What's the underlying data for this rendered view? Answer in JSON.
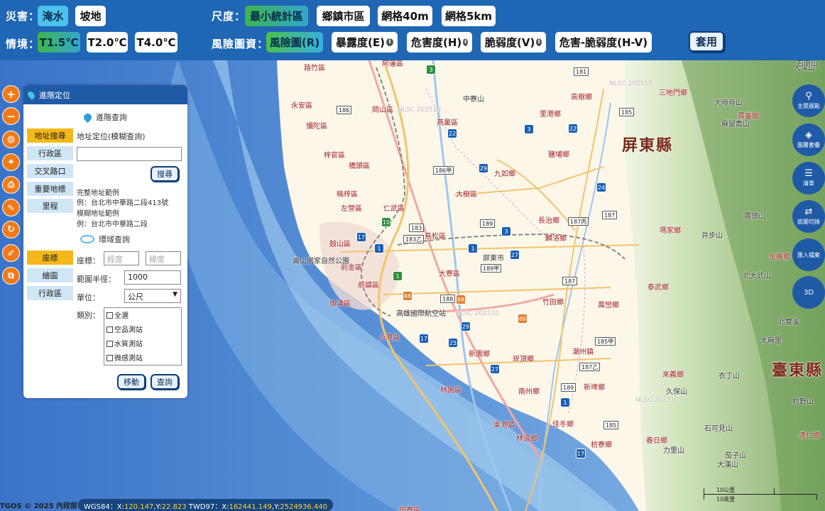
{
  "topbar": {
    "disaster_label": "災害：",
    "disaster_options": [
      "淹水",
      "坡地"
    ],
    "scenario_label": "情境：",
    "scenario_options": [
      "T1.5℃",
      "T2.0℃",
      "T4.0℃"
    ],
    "scale_label": "尺度：",
    "scale_options": [
      "最小統計區",
      "鄉鎮市區",
      "網格40m",
      "網格5km"
    ],
    "risk_label": "風險圖資：",
    "risk_options": [
      "風險圖(R)",
      "暴露度(E)",
      "危害度(H)",
      "脆弱度(V)",
      "危害-脆弱度(H-V)"
    ],
    "apply_label": "套用",
    "selected": {
      "disaster": "淹水",
      "scenario": "T1.5℃",
      "scale": "最小統計區",
      "risk": "風險圖(R)"
    },
    "colors": {
      "bar": "#1f66b5",
      "active_cyan": "#4ac2ea"
    }
  },
  "left_tools": [
    "zoom-in-icon",
    "zoom-out-icon",
    "globe-icon",
    "locate-icon",
    "print-icon",
    "measure-icon",
    "refresh-icon",
    "draw-icon",
    "layers-swap-icon"
  ],
  "panel": {
    "title": "進階定位",
    "address_section_title": "進階查詢",
    "address_tabs": [
      "地址搜尋",
      "行政區",
      "交叉路口",
      "重要地標",
      "里程"
    ],
    "address_mode_text": "地址定位(模糊查詢)",
    "address_input_value": "",
    "search_button": "搜尋",
    "examples": [
      "完整地址範例",
      "例：台北市中華路二段413號",
      "模糊地址範例",
      "例：台北市中華路二段"
    ],
    "env_section_title": "環域查詢",
    "env_tabs": [
      "座標",
      "繪圖",
      "行政區"
    ],
    "coord_label": "座標：",
    "lon_placeholder": "經度",
    "lat_placeholder": "緯度",
    "radius_label": "範圍半徑：",
    "radius_value": "1000",
    "unit_label": "單位：",
    "unit_value": "公尺",
    "category_label": "類別：",
    "categories": [
      "全選",
      "空品測站",
      "水質測站",
      "微感測站"
    ],
    "move_button": "移動",
    "query_button": "查詢"
  },
  "right_buttons": [
    {
      "icon": "theme-icon",
      "label": "主題展點"
    },
    {
      "icon": "layers-icon",
      "label": "圖層套疊"
    },
    {
      "icon": "list-icon",
      "label": "清單"
    },
    {
      "icon": "basemap-switch-icon",
      "label": "底圖切換"
    },
    {
      "icon": "import-icon",
      "label": "匯入檔案"
    },
    {
      "icon": "3d-icon",
      "label": "3D"
    }
  ],
  "map": {
    "county_labels": [
      "屏東縣",
      "臺東縣"
    ],
    "place_labels": [
      "路竹區",
      "阿蓮區",
      "永安區",
      "岡山區",
      "燕巢區",
      "田寮區",
      "高樹鄉",
      "三地門鄉",
      "彌陀區",
      "梓官區",
      "橋頭區",
      "里港鄉",
      "鹽埔鄉",
      "九如鄉",
      "大樹區",
      "楠梓區",
      "仁武區",
      "左營區",
      "鼓山區",
      "鳥松區",
      "長治鄉",
      "麟洛鄉",
      "瑪家鄉",
      "霧臺鄉",
      "屏東市",
      "大寮區",
      "前金區",
      "前鎮區",
      "旗津區",
      "小港區",
      "林園區",
      "東港鎮",
      "新園鄉",
      "崁頂鄉",
      "潮州鎮",
      "南州鄉",
      "新埤鄉",
      "萬巒鄉",
      "竹田鄉",
      "泰武鄉",
      "來義鄉",
      "春日鄉",
      "枋寮鄉",
      "林邊鄉",
      "佳冬鄉",
      "金峰鄉",
      "太麻里",
      "北大武山",
      "高雄國際航空站",
      "壽山國家自然公園",
      "中寮山",
      "大母母山",
      "麻留喬山",
      "霧頭山",
      "井步山",
      "衣丁山",
      "久保山",
      "石可見山",
      "茄子山",
      "大漢山",
      "力里山",
      "北雙溪",
      "大津山",
      "石南山",
      "達仁鄉",
      "枋野山",
      "北大武山"
    ],
    "watermark": "NLSC 202510",
    "routes": [
      "3",
      "22",
      "3",
      "22",
      "186",
      "181",
      "185",
      "186甲",
      "29",
      "24",
      "17",
      "10",
      "183",
      "183乙",
      "1",
      "189",
      "3",
      "1",
      "27",
      "189甲",
      "187丙",
      "187",
      "1",
      "88",
      "188",
      "88",
      "88",
      "29",
      "17",
      "25",
      "27",
      "187乙",
      "185甲",
      "189",
      "1",
      "187",
      "185",
      "17"
    ]
  },
  "footer": {
    "copyright": "TGOS © 2025 內政部",
    "coord_prefix_wgs": "WGS84：X:",
    "wgs_x": "120.147",
    "coord_sep_y1": ",Y:",
    "wgs_y": "22.823",
    "coord_prefix_twd": " TWD97：X:",
    "twd_x": "162441.149",
    "coord_sep_y2": ",Y:",
    "twd_y": "2524936.440",
    "scale_mi": "10公里",
    "scale_km": "10英里"
  }
}
